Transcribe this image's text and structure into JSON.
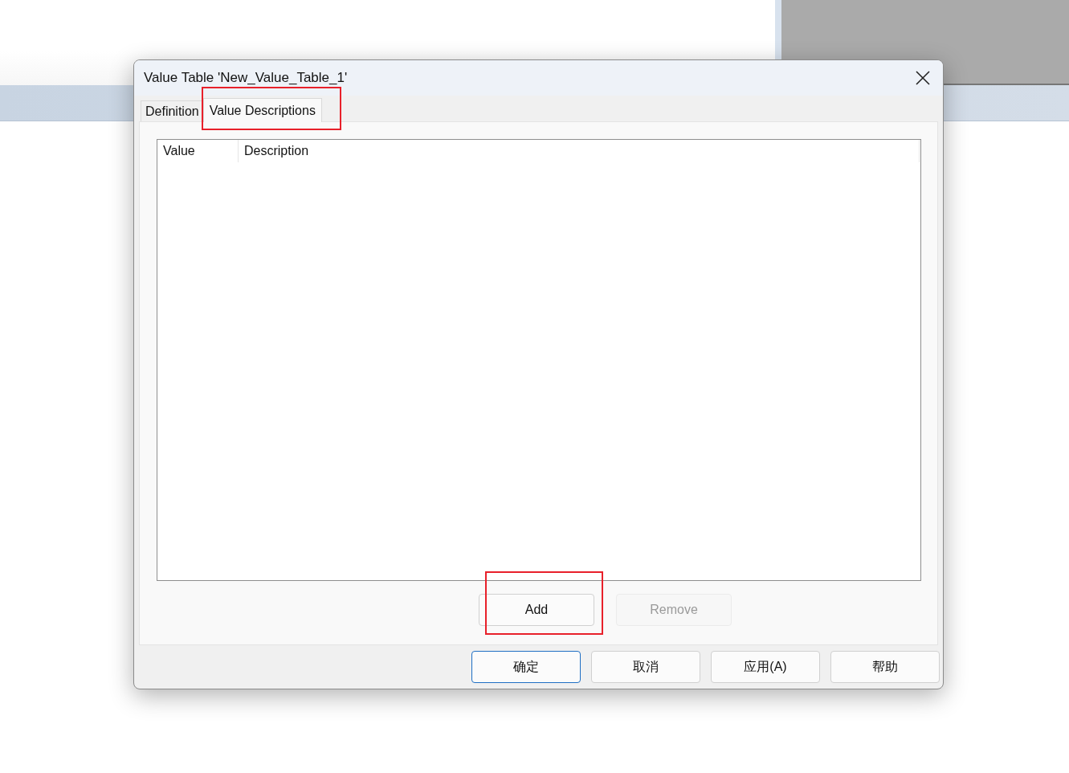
{
  "dialog": {
    "title": "Value Table 'New_Value_Table_1'",
    "tabs": [
      {
        "label": "Definition",
        "selected": false
      },
      {
        "label": "Value Descriptions",
        "selected": true
      }
    ],
    "list": {
      "columns": [
        "Value",
        "Description"
      ]
    },
    "list_buttons": [
      {
        "label": "Add",
        "disabled": false
      },
      {
        "label": "Remove",
        "disabled": true
      }
    ],
    "footer_buttons": [
      {
        "label": "确定",
        "default": true
      },
      {
        "label": "取消",
        "default": false
      },
      {
        "label": "应用(A)",
        "default": false
      },
      {
        "label": "帮助",
        "default": false
      }
    ]
  }
}
